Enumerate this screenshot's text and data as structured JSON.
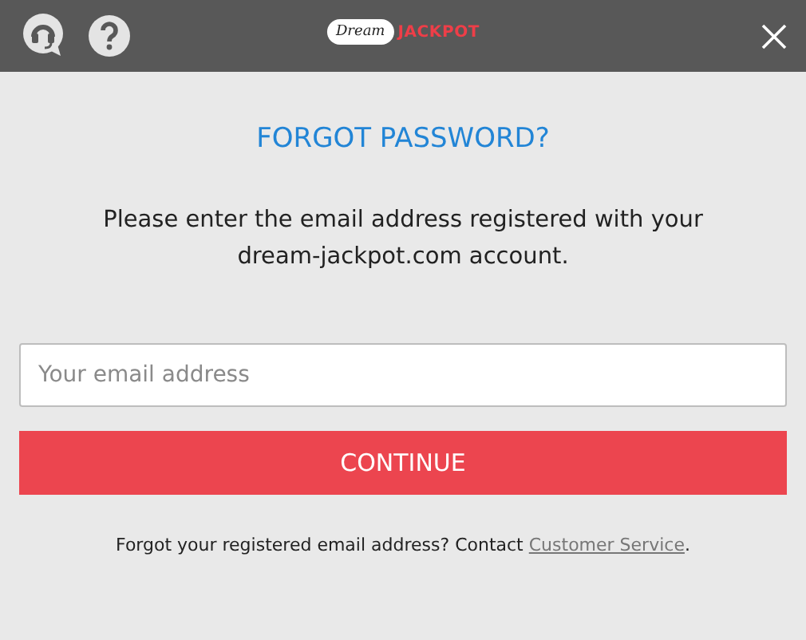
{
  "header": {
    "logo": {
      "script_word": "Dream",
      "word": "JACKPOT"
    }
  },
  "title": "FORGOT PASSWORD?",
  "instructions": "Please enter the email address registered with your dream-jackpot.com account.",
  "email_field": {
    "placeholder": "Your email address"
  },
  "continue_button": "CONTINUE",
  "footer": {
    "text": "Forgot your registered email address? Contact ",
    "link": "Customer Service",
    "end": "."
  }
}
